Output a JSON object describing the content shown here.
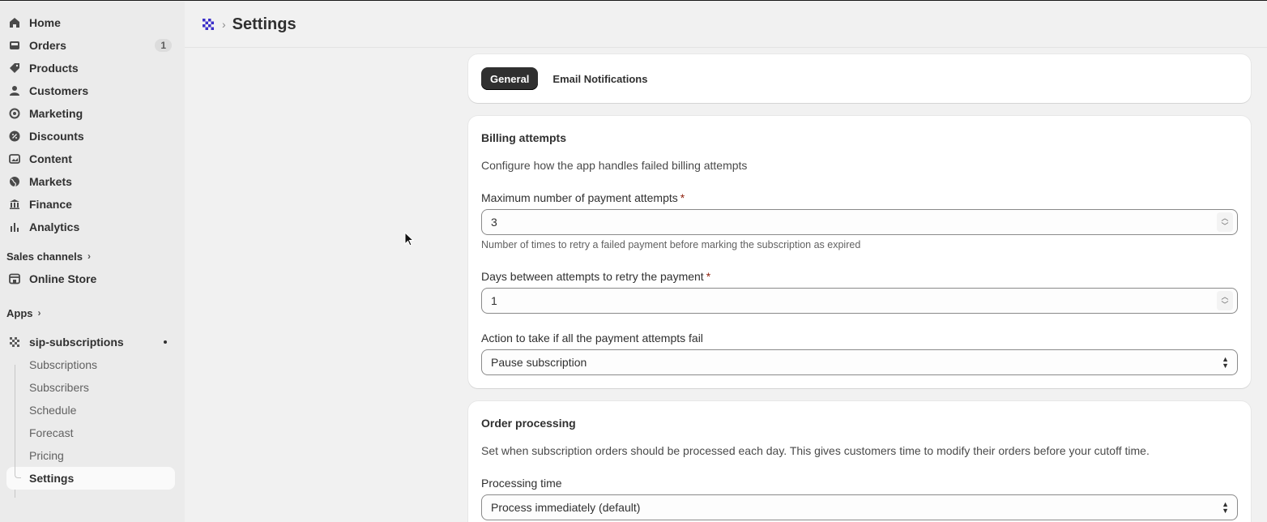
{
  "sidebar": {
    "nav": [
      {
        "label": "Home",
        "icon": "home-icon"
      },
      {
        "label": "Orders",
        "icon": "inbox-icon",
        "badge": "1"
      },
      {
        "label": "Products",
        "icon": "tag-icon"
      },
      {
        "label": "Customers",
        "icon": "person-icon"
      },
      {
        "label": "Marketing",
        "icon": "target-icon"
      },
      {
        "label": "Discounts",
        "icon": "discount-icon"
      },
      {
        "label": "Content",
        "icon": "image-icon"
      },
      {
        "label": "Markets",
        "icon": "globe-icon"
      },
      {
        "label": "Finance",
        "icon": "bank-icon"
      },
      {
        "label": "Analytics",
        "icon": "bar-chart-icon"
      }
    ],
    "sales_channels_label": "Sales channels",
    "online_store_label": "Online Store",
    "apps_label": "Apps",
    "app_name": "sip-subscriptions",
    "app_subitems": [
      "Subscriptions",
      "Subscribers",
      "Schedule",
      "Forecast",
      "Pricing",
      "Settings"
    ]
  },
  "header": {
    "title": "Settings"
  },
  "tabs": [
    {
      "label": "General",
      "active": true
    },
    {
      "label": "Email Notifications",
      "active": false
    }
  ],
  "billing": {
    "title": "Billing attempts",
    "description": "Configure how the app handles failed billing attempts",
    "max_attempts_label": "Maximum number of payment attempts",
    "max_attempts_value": "3",
    "max_attempts_help": "Number of times to retry a failed payment before marking the subscription as expired",
    "days_between_label": "Days between attempts to retry the payment",
    "days_between_value": "1",
    "action_label": "Action to take if all the payment attempts fail",
    "action_value": "Pause subscription"
  },
  "order_processing": {
    "title": "Order processing",
    "description": "Set when subscription orders should be processed each day. This gives customers time to modify their orders before your cutoff time.",
    "processing_time_label": "Processing time",
    "processing_time_value": "Process immediately (default)"
  },
  "required_marker": "*",
  "colors": {
    "accent_dark": "#303030",
    "required": "#8e1f0b",
    "app_logo": "#3b2fc9"
  }
}
